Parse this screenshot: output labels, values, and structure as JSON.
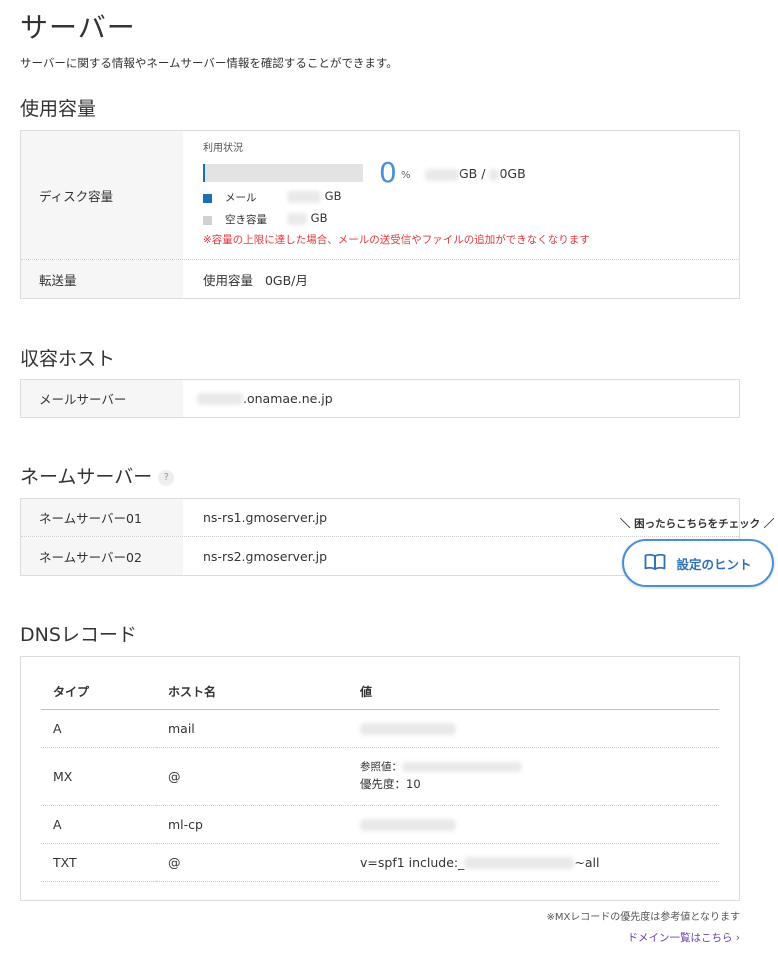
{
  "page": {
    "title": "サーバー",
    "description": "サーバーに関する情報やネームサーバー情報を確認することができます。"
  },
  "usage_section": {
    "title": "使用容量",
    "disk": {
      "label": "ディスク容量",
      "caption": "利用状況",
      "percent": "0",
      "percent_unit": "%",
      "used_fraction": 0.0,
      "total_sep": "GB /",
      "total_unit": "0GB",
      "legend": [
        {
          "label": "メール",
          "unit": "GB",
          "color": "#1a6fb5"
        },
        {
          "label": "空き容量",
          "unit": "GB",
          "color": "#d0d0d0"
        }
      ],
      "warning": "※容量の上限に達した場合、メールの送受信やファイルの追加ができなくなります"
    },
    "transfer": {
      "label": "転送量",
      "value_label": "使用容量",
      "value": "0GB/月"
    }
  },
  "host_section": {
    "title": "収容ホスト",
    "mail_server": {
      "label": "メールサーバー",
      "value_suffix": ".onamae.ne.jp"
    }
  },
  "ns_section": {
    "title": "ネームサーバー",
    "help": "?",
    "rows": [
      {
        "label": "ネームサーバー01",
        "value": "ns-rs1.gmoserver.jp"
      },
      {
        "label": "ネームサーバー02",
        "value": "ns-rs2.gmoserver.jp"
      }
    ]
  },
  "hint": {
    "caption": "＼ 困ったらこちらをチェック ／",
    "button_label": "設定のヒント",
    "icon": "book-icon"
  },
  "dns_section": {
    "title": "DNSレコード",
    "headers": [
      "タイプ",
      "ホスト名",
      "値"
    ],
    "records": [
      {
        "type": "A",
        "host": "mail",
        "value": ""
      },
      {
        "type": "MX",
        "host": "@",
        "ref_label": "参照値：",
        "priority_label": "優先度：",
        "priority": "10"
      },
      {
        "type": "A",
        "host": "ml-cp",
        "value": ""
      },
      {
        "type": "TXT",
        "host": "@",
        "value_prefix": "v=spf1 include:_",
        "value_suffix": "~all"
      }
    ],
    "footnote": "※MXレコードの優先度は参考値となります",
    "domain_link": "ドメイン一覧はこちら ›"
  },
  "colors": {
    "accent": "#4a90d9",
    "warning": "#e0393e",
    "link": "#6a3fa8"
  }
}
